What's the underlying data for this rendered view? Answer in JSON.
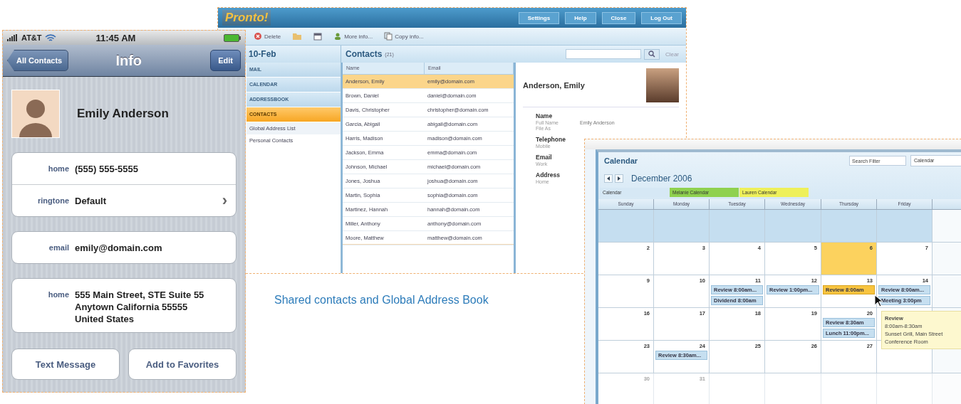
{
  "phone": {
    "carrier": "AT&T",
    "time": "11:45 AM",
    "back": "All Contacts",
    "title": "Info",
    "edit": "Edit",
    "name": "Emily Anderson",
    "groups": [
      {
        "rows": [
          {
            "kind": "field",
            "label": "home",
            "value": "(555) 555-5555"
          },
          {
            "kind": "link",
            "label": "ringtone",
            "value": "Default",
            "chevron": "›"
          }
        ]
      },
      {
        "rows": [
          {
            "kind": "field",
            "label": "email",
            "value": "emily@domain.com"
          }
        ]
      },
      {
        "rows": [
          {
            "kind": "address",
            "label": "home",
            "lines": [
              "555 Main Street, STE Suite 55",
              "Anytown California 55555",
              "United States"
            ]
          }
        ]
      }
    ],
    "buttons": [
      "Text Message",
      "Add to Favorites"
    ]
  },
  "webmail": {
    "logo": "Pronto!",
    "header_buttons": [
      "Settings",
      "Help",
      "Close",
      "Log Out"
    ],
    "toolbar": [
      {
        "kind": "delete",
        "label": "Delete"
      },
      {
        "kind": "folder"
      },
      {
        "kind": "calendar"
      },
      {
        "kind": "more",
        "label": "More info..."
      },
      {
        "kind": "copy",
        "label": "Copy info..."
      }
    ],
    "sidebar": {
      "date": "10-Feb",
      "items": [
        {
          "label": "MAIL",
          "selected": false
        },
        {
          "label": "CALENDAR",
          "selected": false
        },
        {
          "label": "ADDRESSBOOK",
          "selected": false
        },
        {
          "label": "CONTACTS",
          "selected": true,
          "children": [
            {
              "label": "Global Address List"
            },
            {
              "label": "Personal Contacts"
            }
          ]
        }
      ]
    },
    "contacts": {
      "title": "Contacts",
      "count": "(21)",
      "clear": "Clear",
      "columns": [
        "Name",
        "Email"
      ],
      "rows": [
        {
          "name": "Anderson, Emily",
          "email": "emily@domain.com",
          "selected": true
        },
        {
          "name": "Brown, Daniel",
          "email": "daniel@domain.com",
          "selected": false
        },
        {
          "name": "Davis, Christopher",
          "email": "christopher@domain.com",
          "selected": false
        },
        {
          "name": "Garcia, Abigail",
          "email": "abigail@domain.com",
          "selected": false
        },
        {
          "name": "Harris, Madison",
          "email": "madison@domain.com",
          "selected": false
        },
        {
          "name": "Jackson, Emma",
          "email": "emma@domain.com",
          "selected": false
        },
        {
          "name": "Johnson, Michael",
          "email": "michael@domain.com",
          "selected": false
        },
        {
          "name": "Jones, Joshua",
          "email": "joshua@domain.com",
          "selected": false
        },
        {
          "name": "Martin, Sophia",
          "email": "sophia@domain.com",
          "selected": false
        },
        {
          "name": "Martinez, Hannah",
          "email": "hannah@domain.com",
          "selected": false
        },
        {
          "name": "Miller, Anthony",
          "email": "anthony@domain.com",
          "selected": false
        },
        {
          "name": "Moore, Matthew",
          "email": "matthew@domain.com",
          "selected": false
        }
      ]
    },
    "detail": {
      "name": "Anderson, Emily",
      "sections": [
        {
          "heading": "Name",
          "lines": [
            {
              "label": "Full Name",
              "value": "Emily Anderson"
            },
            {
              "label": "File As"
            }
          ]
        },
        {
          "heading": "Telephone",
          "lines": [
            {
              "label": "Mobile"
            }
          ]
        },
        {
          "heading": "Email",
          "lines": [
            {
              "label": "Work"
            }
          ]
        },
        {
          "heading": "Address",
          "lines": [
            {
              "label": "Home"
            }
          ]
        }
      ]
    }
  },
  "caption": "Shared contacts and Global Address Book",
  "calendar": {
    "title": "Calendar",
    "search_placeholder": "Search Filter",
    "view": "Calendar",
    "month": "December 2006",
    "legend": [
      {
        "label": "Calendar",
        "color": "#d6e8f5"
      },
      {
        "label": "Melanie Calendar",
        "color": "#8fd14f"
      },
      {
        "label": "Lauren Calendar",
        "color": "#eef05a"
      }
    ],
    "weekdays": [
      "Sunday",
      "Monday",
      "Tuesday",
      "Wednesday",
      "Thursday",
      "Friday"
    ],
    "weeks": [
      {
        "kind": "previous",
        "days": [
          {
            "today": false
          },
          {
            "today": false
          },
          {
            "today": false
          },
          {
            "today": false
          },
          {
            "today": false
          },
          {
            "today": false
          }
        ]
      },
      {
        "kind": "current",
        "days": [
          {
            "date": "2",
            "today": false
          },
          {
            "date": "3",
            "today": false
          },
          {
            "date": "4",
            "today": false
          },
          {
            "date": "5",
            "today": false
          },
          {
            "date": "6",
            "today": true
          },
          {
            "date": "7",
            "today": false
          }
        ]
      },
      {
        "kind": "current",
        "days": [
          {
            "date": "9",
            "today": false
          },
          {
            "date": "10",
            "today": false
          },
          {
            "date": "11",
            "today": false,
            "events": [
              {
                "label": "Review 8:00am...",
                "selected": false
              },
              {
                "label": "Dividend 8:00am",
                "selected": false
              }
            ]
          },
          {
            "date": "12",
            "today": false,
            "events": [
              {
                "label": "Review 1:00pm...",
                "selected": false
              }
            ]
          },
          {
            "date": "13",
            "today": false,
            "events": [
              {
                "label": "Review 8:00am",
                "selected": true
              }
            ]
          },
          {
            "date": "14",
            "today": false,
            "events": [
              {
                "label": "Review 8:00am...",
                "selected": false
              },
              {
                "label": "Meeting 3:00pm",
                "selected": false
              }
            ]
          }
        ]
      },
      {
        "kind": "current",
        "days": [
          {
            "date": "16",
            "today": false
          },
          {
            "date": "17",
            "today": false
          },
          {
            "date": "18",
            "today": false
          },
          {
            "date": "19",
            "today": false
          },
          {
            "date": "20",
            "today": false,
            "events": [
              {
                "label": "Review 8:30am",
                "selected": false
              },
              {
                "label": "Lunch 11:00pm...",
                "selected": false
              }
            ]
          },
          {
            "today": false
          }
        ]
      },
      {
        "kind": "current",
        "days": [
          {
            "date": "23",
            "today": false
          },
          {
            "date": "24",
            "today": false,
            "events": [
              {
                "label": "Review 8:30am...",
                "selected": false
              }
            ]
          },
          {
            "date": "25",
            "today": false
          },
          {
            "date": "26",
            "today": false
          },
          {
            "date": "27",
            "today": false
          },
          {
            "today": false
          }
        ]
      },
      {
        "kind": "faded",
        "days": [
          {
            "date": "30",
            "today": false
          },
          {
            "date": "31",
            "today": false
          },
          {
            "today": false
          },
          {
            "today": false
          },
          {
            "today": false
          },
          {
            "today": false
          }
        ]
      }
    ],
    "tooltip": {
      "title": "Review",
      "lines": [
        "8:00am-8:30am",
        "Sunset Grill, Main Street",
        "Conference Room"
      ]
    }
  }
}
